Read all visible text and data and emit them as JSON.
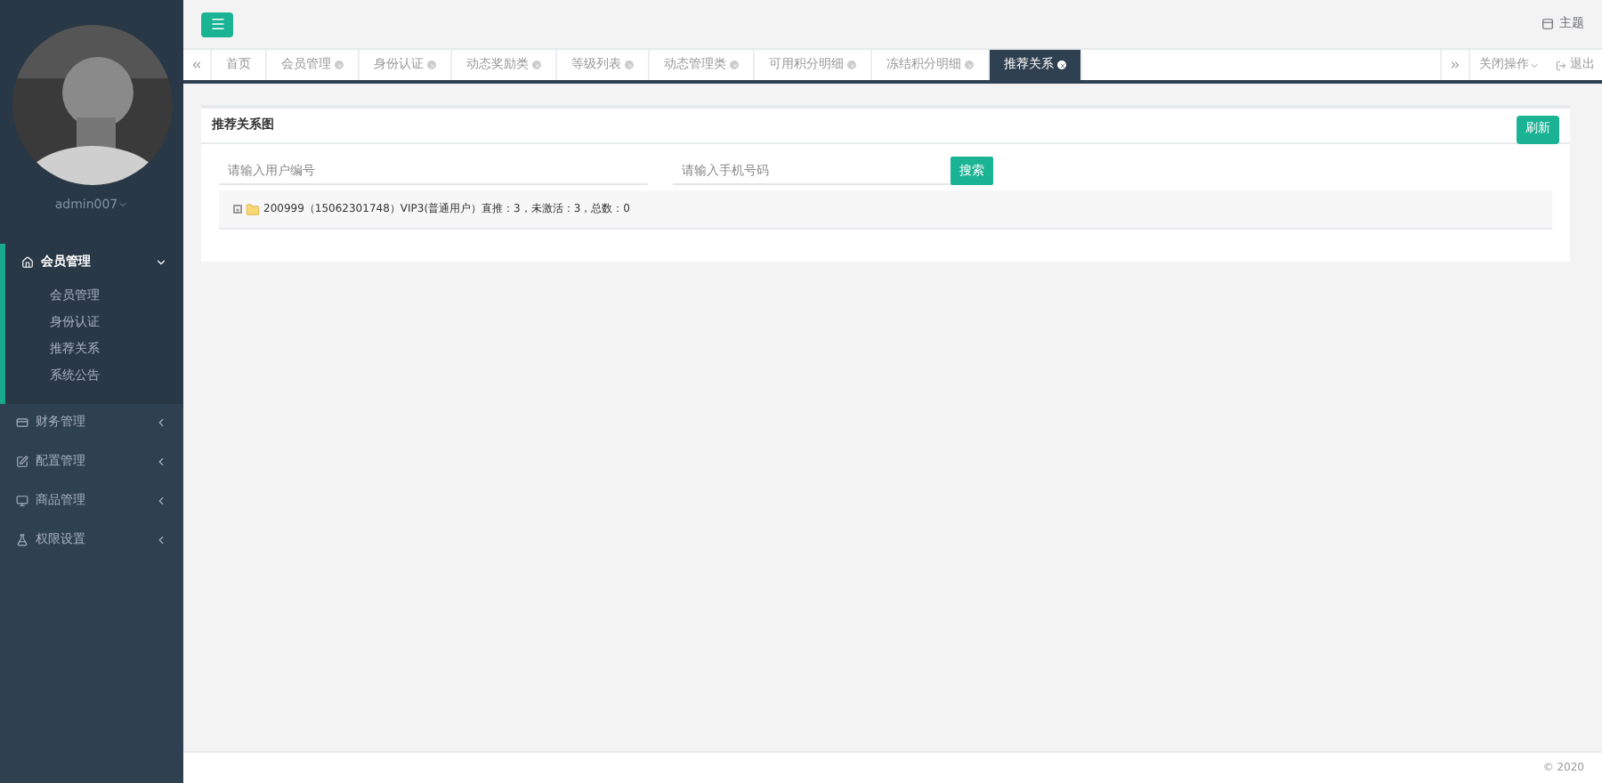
{
  "sidebar": {
    "user": "admin007",
    "menus": [
      {
        "label": "会员管理",
        "expanded": true,
        "children": [
          {
            "label": "会员管理"
          },
          {
            "label": "身份认证"
          },
          {
            "label": "推荐关系"
          },
          {
            "label": "系统公告"
          }
        ]
      },
      {
        "label": "财务管理",
        "expanded": false
      },
      {
        "label": "配置管理",
        "expanded": false
      },
      {
        "label": "商品管理",
        "expanded": false
      },
      {
        "label": "权限设置",
        "expanded": false
      }
    ]
  },
  "header": {
    "theme": "主题"
  },
  "tabs": [
    {
      "label": "首页",
      "closable": false,
      "selected": false
    },
    {
      "label": "会员管理",
      "closable": true,
      "selected": false
    },
    {
      "label": "身份认证",
      "closable": true,
      "selected": false
    },
    {
      "label": "动态奖励类",
      "closable": true,
      "selected": false
    },
    {
      "label": "等级列表",
      "closable": true,
      "selected": false
    },
    {
      "label": "动态管理类",
      "closable": true,
      "selected": false
    },
    {
      "label": "可用积分明细",
      "closable": true,
      "selected": false
    },
    {
      "label": "冻结积分明细",
      "closable": true,
      "selected": false
    },
    {
      "label": "推荐关系",
      "closable": true,
      "selected": true
    }
  ],
  "tab_actions": {
    "close": "关闭操作",
    "logout": "退出"
  },
  "panel": {
    "title": "推荐关系图",
    "refresh": "刷新",
    "user_placeholder": "请输入用户编号",
    "phone_placeholder": "请输入手机号码",
    "search": "搜索",
    "tree": [
      {
        "text": "200999（15062301748）VIP3(普通用户）直推：3，未激活：3，总数：0",
        "expanded": false
      }
    ]
  },
  "footer": "© 2020"
}
